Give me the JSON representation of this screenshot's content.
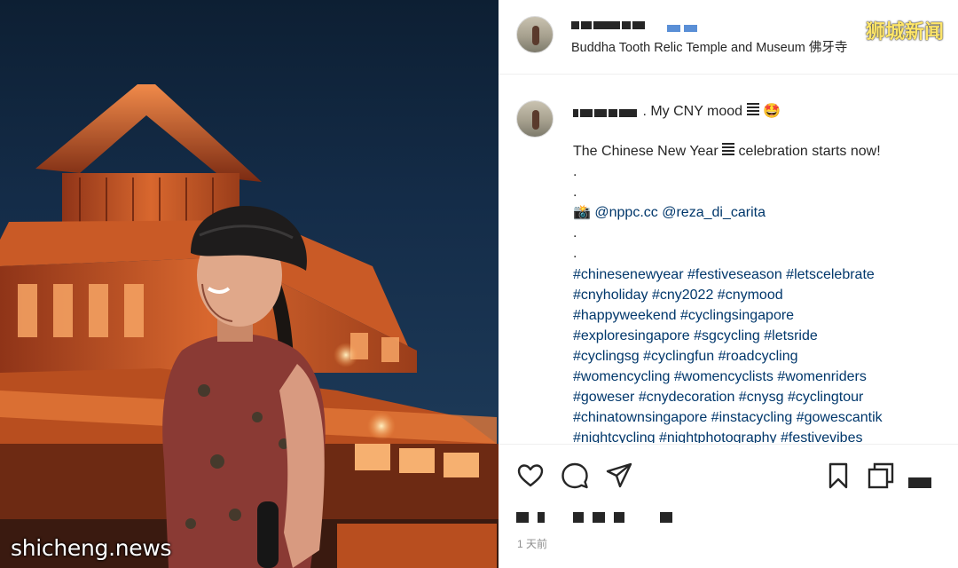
{
  "post": {
    "location": "Buddha Tooth Relic Temple and Museum 佛牙寺",
    "title_text": ". My CNY mood",
    "caption_lines": [
      {
        "type": "text",
        "parts": [
          {
            "t": "The Chinese New Year "
          },
          {
            "g": "lines"
          },
          {
            "t": " celebration starts now!"
          }
        ]
      },
      {
        "type": "dot",
        "text": "."
      },
      {
        "type": "dot",
        "text": "."
      },
      {
        "type": "credit",
        "emoji": "📸",
        "mentions": [
          "@nppc.cc",
          "@reza_di_carita"
        ]
      },
      {
        "type": "dot",
        "text": "."
      },
      {
        "type": "dot",
        "text": "."
      },
      {
        "type": "tags",
        "tags": [
          "#chinesenewyear",
          "#festiveseason",
          "#letscelebrate"
        ]
      },
      {
        "type": "tags",
        "tags": [
          "#cnyholiday",
          "#cny2022",
          "#cnymood"
        ]
      },
      {
        "type": "tags",
        "tags": [
          "#happyweekend",
          "#cyclingsingapore"
        ]
      },
      {
        "type": "tags",
        "tags": [
          "#exploresingapore",
          "#sgcycling",
          "#letsride"
        ]
      },
      {
        "type": "tags",
        "tags": [
          "#cyclingsg",
          "#cyclingfun",
          "#roadcycling"
        ]
      },
      {
        "type": "tags",
        "tags": [
          "#womencycling",
          "#womencyclists",
          "#womenriders"
        ]
      },
      {
        "type": "tags",
        "tags": [
          "#goweser",
          "#cnydecoration",
          "#cnysg",
          "#cyclingtour"
        ]
      },
      {
        "type": "tags",
        "tags": [
          "#chinatownsingapore",
          "#instacycling",
          "#gowescantik"
        ]
      },
      {
        "type": "tags",
        "tags": [
          "#nightcycling",
          "#nightphotography",
          "#festivevibes"
        ]
      }
    ],
    "timestamp": "1 天前"
  },
  "watermarks": {
    "top_right": "狮城新闻",
    "bottom_left": "shicheng.news"
  },
  "icons": {
    "like": "heart-icon",
    "comment": "comment-icon",
    "share": "paper-plane-icon",
    "save": "bookmark-icon",
    "collection": "copy-icon"
  },
  "colors": {
    "hashtag": "#00376b",
    "text": "#262626",
    "muted": "#8e8e8e",
    "verified_redaction": "#5a8fd6",
    "watermark": "#ffe66a"
  }
}
